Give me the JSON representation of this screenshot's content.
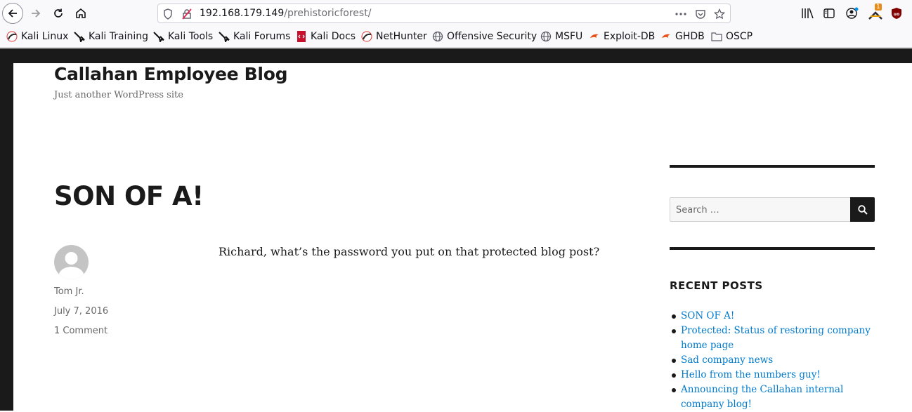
{
  "browser": {
    "url_host": "192.168.179.149",
    "url_path": "/prehistoricforest/",
    "extension_badge": "1"
  },
  "bookmarks": [
    {
      "label": "Kali Linux",
      "icon": "kali-dragon-icon"
    },
    {
      "label": "Kali Training",
      "icon": "kali-dragon-icon"
    },
    {
      "label": "Kali Tools",
      "icon": "kali-dragon-icon"
    },
    {
      "label": "Kali Forums",
      "icon": "kali-dragon-icon"
    },
    {
      "label": "Kali Docs",
      "icon": "kali-docs-icon"
    },
    {
      "label": "NetHunter",
      "icon": "nethunter-icon"
    },
    {
      "label": "Offensive Security",
      "icon": "globe-icon"
    },
    {
      "label": "MSFU",
      "icon": "globe-icon"
    },
    {
      "label": "Exploit-DB",
      "icon": "exploitdb-icon"
    },
    {
      "label": "GHDB",
      "icon": "exploitdb-icon"
    },
    {
      "label": "OSCP",
      "icon": "folder-icon"
    }
  ],
  "site": {
    "title": "Callahan Employee Blog",
    "description": "Just another WordPress site"
  },
  "post": {
    "title": "SON OF A!",
    "author": "Tom Jr.",
    "date": "July 7, 2016",
    "comments": "1 Comment",
    "content": "Richard, what’s the password you put on that protected blog post?"
  },
  "sidebar": {
    "search_placeholder": "Search …",
    "recent_title": "RECENT POSTS",
    "recent_posts": [
      [
        "SON OF A!"
      ],
      [
        "Protected: Status of restoring company",
        "home page"
      ],
      [
        "Sad company news"
      ],
      [
        "Hello from the numbers guy!"
      ],
      [
        "Announcing the Callahan internal",
        "company blog!"
      ]
    ]
  },
  "colors": {
    "link": "#007acc",
    "text": "#1a1a1a",
    "meta": "#686868"
  }
}
